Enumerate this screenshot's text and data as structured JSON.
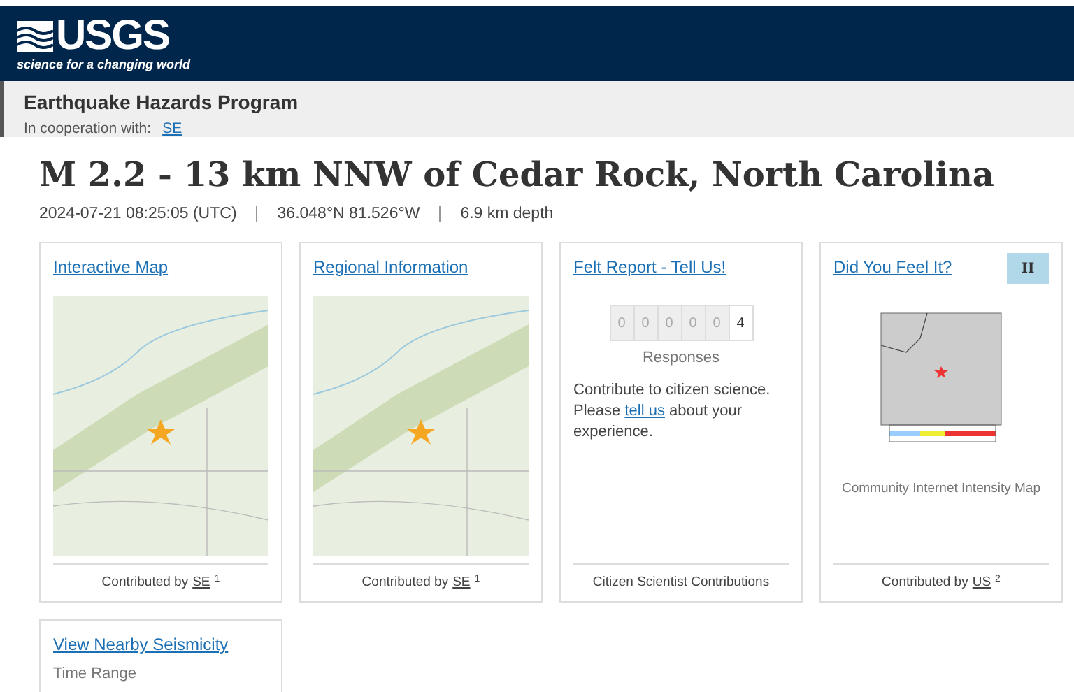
{
  "header": {
    "logo": "USGS",
    "tagline": "science for a changing world"
  },
  "program": {
    "title": "Earthquake Hazards Program",
    "cooperation_label": "In cooperation with:",
    "cooperation_link": "SE"
  },
  "event": {
    "title": "M 2.2 - 13 km NNW of Cedar Rock, North Carolina",
    "time": "2024-07-21 08:25:05 (UTC)",
    "location": "36.048°N 81.526°W",
    "depth": "6.9 km depth"
  },
  "cards": [
    {
      "kind": "map",
      "title": "Interactive Map",
      "footer": {
        "prefix": "Contributed by",
        "source": "SE",
        "note": "1"
      }
    },
    {
      "kind": "map",
      "title": "Regional Information",
      "footer": {
        "prefix": "Contributed by",
        "source": "SE",
        "note": "1"
      }
    },
    {
      "kind": "felt",
      "title": "Felt Report - Tell Us!",
      "digits": [
        {
          "value": "0",
          "lit": false
        },
        {
          "value": "0",
          "lit": false
        },
        {
          "value": "0",
          "lit": false
        },
        {
          "value": "0",
          "lit": false
        },
        {
          "value": "0",
          "lit": false
        },
        {
          "value": "4",
          "lit": true
        }
      ],
      "counter_label": "Responses",
      "text_before": "Contribute to citizen science. Please",
      "link": "tell us",
      "text_after": "about your experience.",
      "footer": {
        "prefix": "Citizen Scientist Contributions"
      }
    },
    {
      "kind": "dyfi",
      "title": "Did You Feel It?",
      "badge": "II",
      "color": "#b0d8e8",
      "caption": "Community Internet Intensity Map",
      "footer": {
        "prefix": "Contributed by",
        "source": "US",
        "note": "2"
      }
    },
    {
      "kind": "nearby",
      "title": "View Nearby Seismicity",
      "subtitle": "Time Range"
    }
  ]
}
